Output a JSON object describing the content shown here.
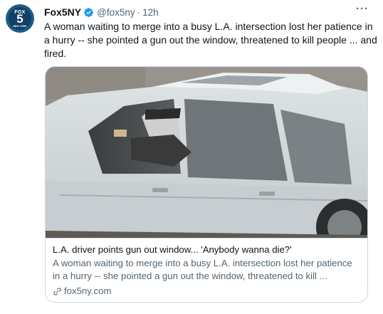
{
  "account": {
    "name": "Fox5NY",
    "handle": "@fox5ny",
    "separator": "·",
    "time": "12h",
    "avatar_text": {
      "brand": "FOX",
      "number": "5",
      "city": "NEW YORK"
    }
  },
  "tweet": {
    "text": "A woman waiting to merge into a busy L.A. intersection lost her patience in a hurry -- she pointed a gun out the window, threatened to kill people ... and fired."
  },
  "more_menu": {
    "label": "···"
  },
  "card": {
    "title": "L.A. driver points gun out window... 'Anybody wanna die?'",
    "description": "A woman waiting to merge into a busy L.A. intersection lost her patience in a hurry -- she pointed a gun out the window, threatened to kill ...",
    "domain": "fox5ny.com"
  },
  "colors": {
    "text_primary": "#0f1419",
    "text_secondary": "#536471",
    "verified_blue": "#1d9bf0",
    "border": "#cfd9de",
    "avatar_bg": "#1b5c8a"
  },
  "icons": {
    "verified": "verified-badge-icon",
    "more": "more-dots-icon",
    "link": "link-icon"
  }
}
